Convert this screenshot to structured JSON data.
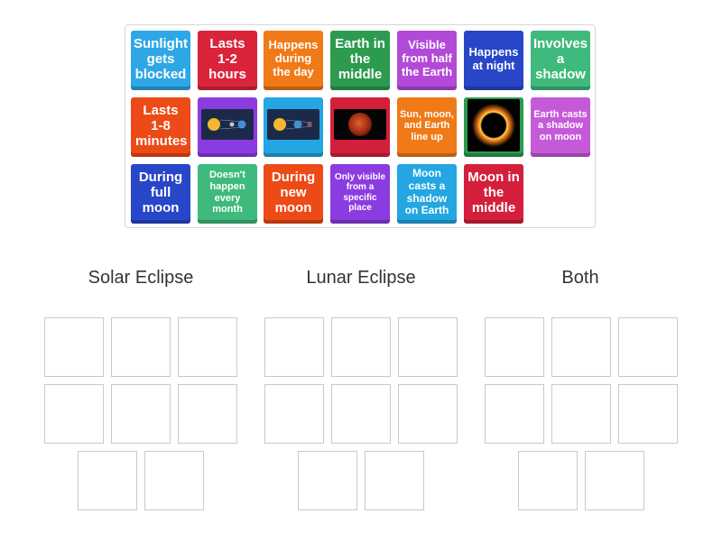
{
  "tiles": [
    {
      "label": "Sunlight gets blocked",
      "color": "#2ea7e6"
    },
    {
      "label": "Lasts 1-2 hours",
      "color": "#d9243a"
    },
    {
      "label": "Happens during the day",
      "color": "#f07a18"
    },
    {
      "label": "Earth in the middle",
      "color": "#2c9b50"
    },
    {
      "label": "Visible from half the Earth",
      "color": "#b24ad7"
    },
    {
      "label": "Happens at night",
      "color": "#2846c8"
    },
    {
      "label": "Involves a shadow",
      "color": "#3fba7c"
    },
    {
      "label": "Lasts 1-8 minutes",
      "color": "#ec4a16"
    },
    {
      "image": "sun-earth-moon-diagram-solar",
      "color": "#8b3ce0"
    },
    {
      "image": "sun-earth-moon-diagram-lunar",
      "color": "#23a6e1"
    },
    {
      "image": "red-blood-moon-photo",
      "color": "#d41f3c"
    },
    {
      "image": "total-solar-eclipse-ring-photo",
      "color": "#2c9b50"
    },
    {
      "label": "Sun, moon, and Earth line up",
      "color": "#f07a18"
    },
    {
      "label": "Earth casts a shadow on moon",
      "color": "#c55ad9"
    },
    {
      "label": "During full moon",
      "color": "#2846c8"
    },
    {
      "label": "Doesn't happen every month",
      "color": "#3fba7c"
    },
    {
      "label": "During new moon",
      "color": "#ec4a16"
    },
    {
      "label": "Only visible from a specific place",
      "color": "#8b3ce0"
    },
    {
      "label": "Moon casts a shadow on Earth",
      "color": "#23a6e1"
    },
    {
      "label": "Moon in the middle",
      "color": "#d41f3c"
    }
  ],
  "groups": [
    {
      "title": "Solar Eclipse",
      "slots": 8
    },
    {
      "title": "Lunar Eclipse",
      "slots": 8
    },
    {
      "title": "Both",
      "slots": 8
    }
  ]
}
